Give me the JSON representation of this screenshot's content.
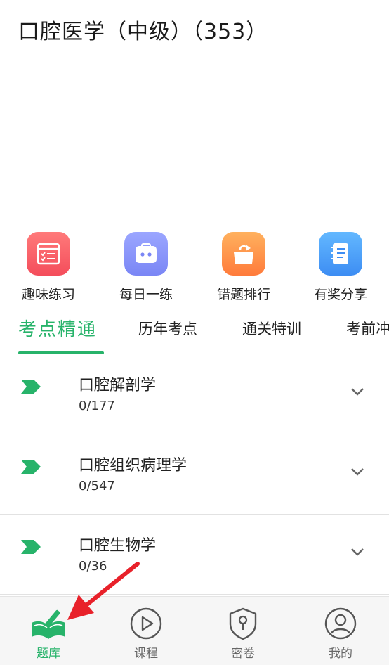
{
  "header": {
    "title": "口腔医学（中级）（353）"
  },
  "features": [
    {
      "label": "趣味练习",
      "icon": "practice-icon",
      "color_from": "#ff7a7a",
      "color_to": "#f44d5b"
    },
    {
      "label": "每日一练",
      "icon": "daily-icon",
      "color_from": "#9ba6ff",
      "color_to": "#7a86f5"
    },
    {
      "label": "错题排行",
      "icon": "mistakes-icon",
      "color_from": "#ffb15e",
      "color_to": "#ff7b3b"
    },
    {
      "label": "有奖分享",
      "icon": "share-icon",
      "color_from": "#63b8ff",
      "color_to": "#3d8df3"
    }
  ],
  "tabs": [
    {
      "label": "考点精通",
      "active": true
    },
    {
      "label": "历年考点"
    },
    {
      "label": "通关特训"
    },
    {
      "label": "考前冲"
    }
  ],
  "list": [
    {
      "name": "口腔解剖学",
      "count": "0/177"
    },
    {
      "name": "口腔组织病理学",
      "count": "0/547"
    },
    {
      "name": "口腔生物学",
      "count": "0/36"
    }
  ],
  "bottom_nav": [
    {
      "label": "题库",
      "icon": "book-pencil-icon",
      "active": true
    },
    {
      "label": "课程",
      "icon": "play-icon"
    },
    {
      "label": "密卷",
      "icon": "shield-lock-icon"
    },
    {
      "label": "我的",
      "icon": "user-icon"
    }
  ],
  "colors": {
    "accent": "#27b36a",
    "annotation_arrow": "#e8212a"
  }
}
